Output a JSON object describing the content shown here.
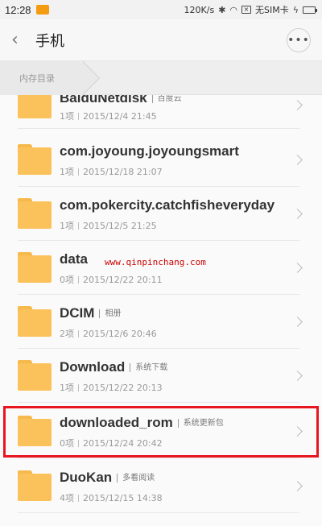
{
  "status_bar": {
    "time": "12:28",
    "speed": "120K/s",
    "sim": "无SIM卡"
  },
  "header": {
    "title": "手机"
  },
  "breadcrumb": {
    "label": "内存目录"
  },
  "files": [
    {
      "name": "BaiduNetdisk",
      "alias": "百度云",
      "count": "1项",
      "date": "2015/12/4 21:45"
    },
    {
      "name": "com.joyoung.joyoungsmart",
      "alias": "",
      "count": "1项",
      "date": "2015/12/18 21:07"
    },
    {
      "name": "com.pokercity.catchfisheveryday",
      "alias": "",
      "count": "1项",
      "date": "2015/12/5 21:25"
    },
    {
      "name": "data",
      "alias": "",
      "count": "0项",
      "date": "2015/12/22 20:11"
    },
    {
      "name": "DCIM",
      "alias": "相册",
      "count": "2项",
      "date": "2015/12/6 20:46"
    },
    {
      "name": "Download",
      "alias": "系统下载",
      "count": "1项",
      "date": "2015/12/22 20:13"
    },
    {
      "name": "downloaded_rom",
      "alias": "系统更新包",
      "count": "0项",
      "date": "2015/12/24 20:42"
    },
    {
      "name": "DuoKan",
      "alias": "多看阅读",
      "count": "4项",
      "date": "2015/12/15 14:38"
    }
  ],
  "watermark": "www.qinpinchang.com",
  "colors": {
    "folder": "#fbc15a",
    "highlight": "#e8161f"
  }
}
